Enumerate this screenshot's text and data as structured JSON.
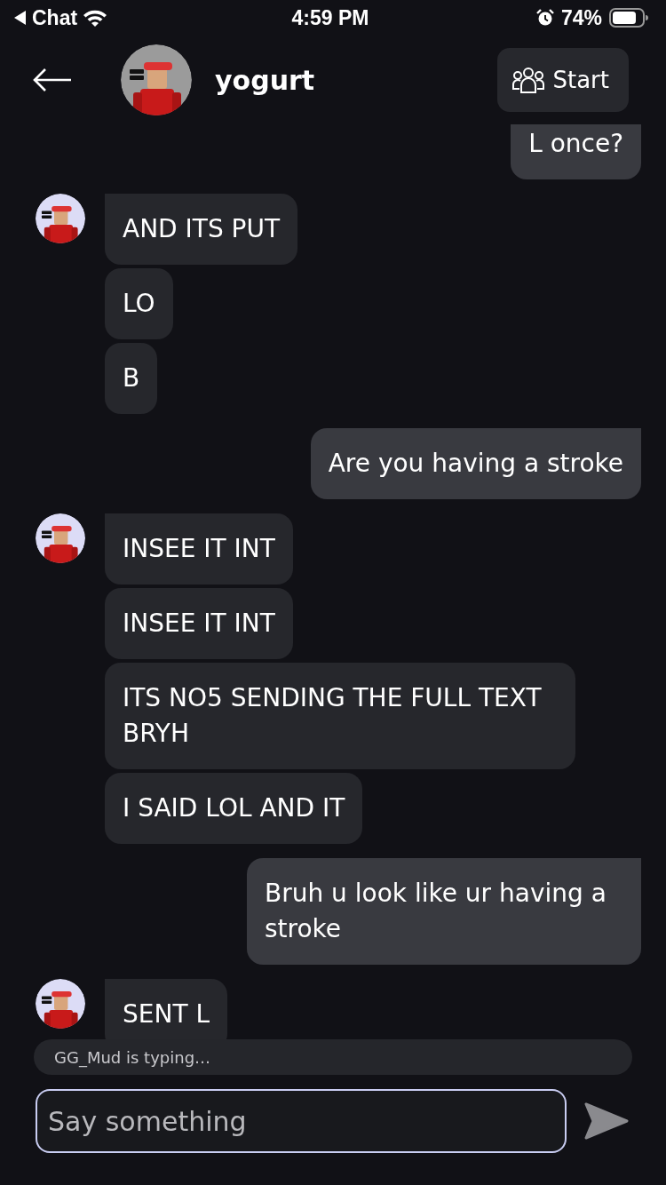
{
  "status_bar": {
    "back_app": "Chat",
    "time": "4:59 PM",
    "battery": "74%"
  },
  "header": {
    "name": "yogurt",
    "start_button": "Start"
  },
  "messages": [
    {
      "kind": "outgoing",
      "texts": [
        "L once?"
      ]
    },
    {
      "kind": "incoming",
      "texts": [
        "AND ITS PUT",
        "LO",
        "B"
      ]
    },
    {
      "kind": "outgoing",
      "texts": [
        "Are you having a stroke"
      ]
    },
    {
      "kind": "incoming",
      "texts": [
        "INSEE IT INT",
        "INSEE IT INT",
        "ITS NO5 SENDING THE FULL TEXT BRYH",
        "I SAID LOL AND IT"
      ]
    },
    {
      "kind": "outgoing",
      "texts": [
        "Bruh u look like ur having a stroke"
      ]
    },
    {
      "kind": "incoming",
      "texts": [
        "SENT L"
      ]
    }
  ],
  "typing_indicator": "GG_Mud is typing…",
  "composer": {
    "placeholder": "Say something"
  }
}
